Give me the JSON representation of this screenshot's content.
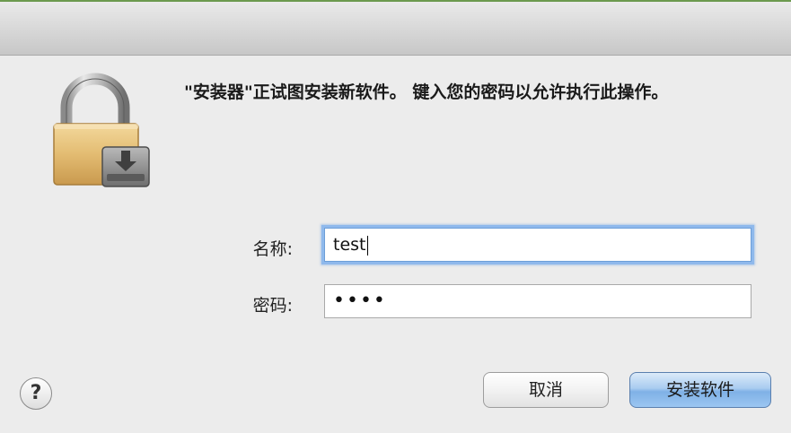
{
  "dialog": {
    "message": "\"安装器\"正试图安装新软件。 键入您的密码以允许执行此操作。",
    "icon": "lock-with-installer-icon"
  },
  "form": {
    "name_label": "名称:",
    "name_value": "test",
    "password_label": "密码:",
    "password_value": "••••"
  },
  "buttons": {
    "help": "?",
    "cancel": "取消",
    "install": "安装软件"
  },
  "colors": {
    "background": "#ececec",
    "focus_ring": "#8fb9ec",
    "default_button": "#9cc6f1"
  }
}
